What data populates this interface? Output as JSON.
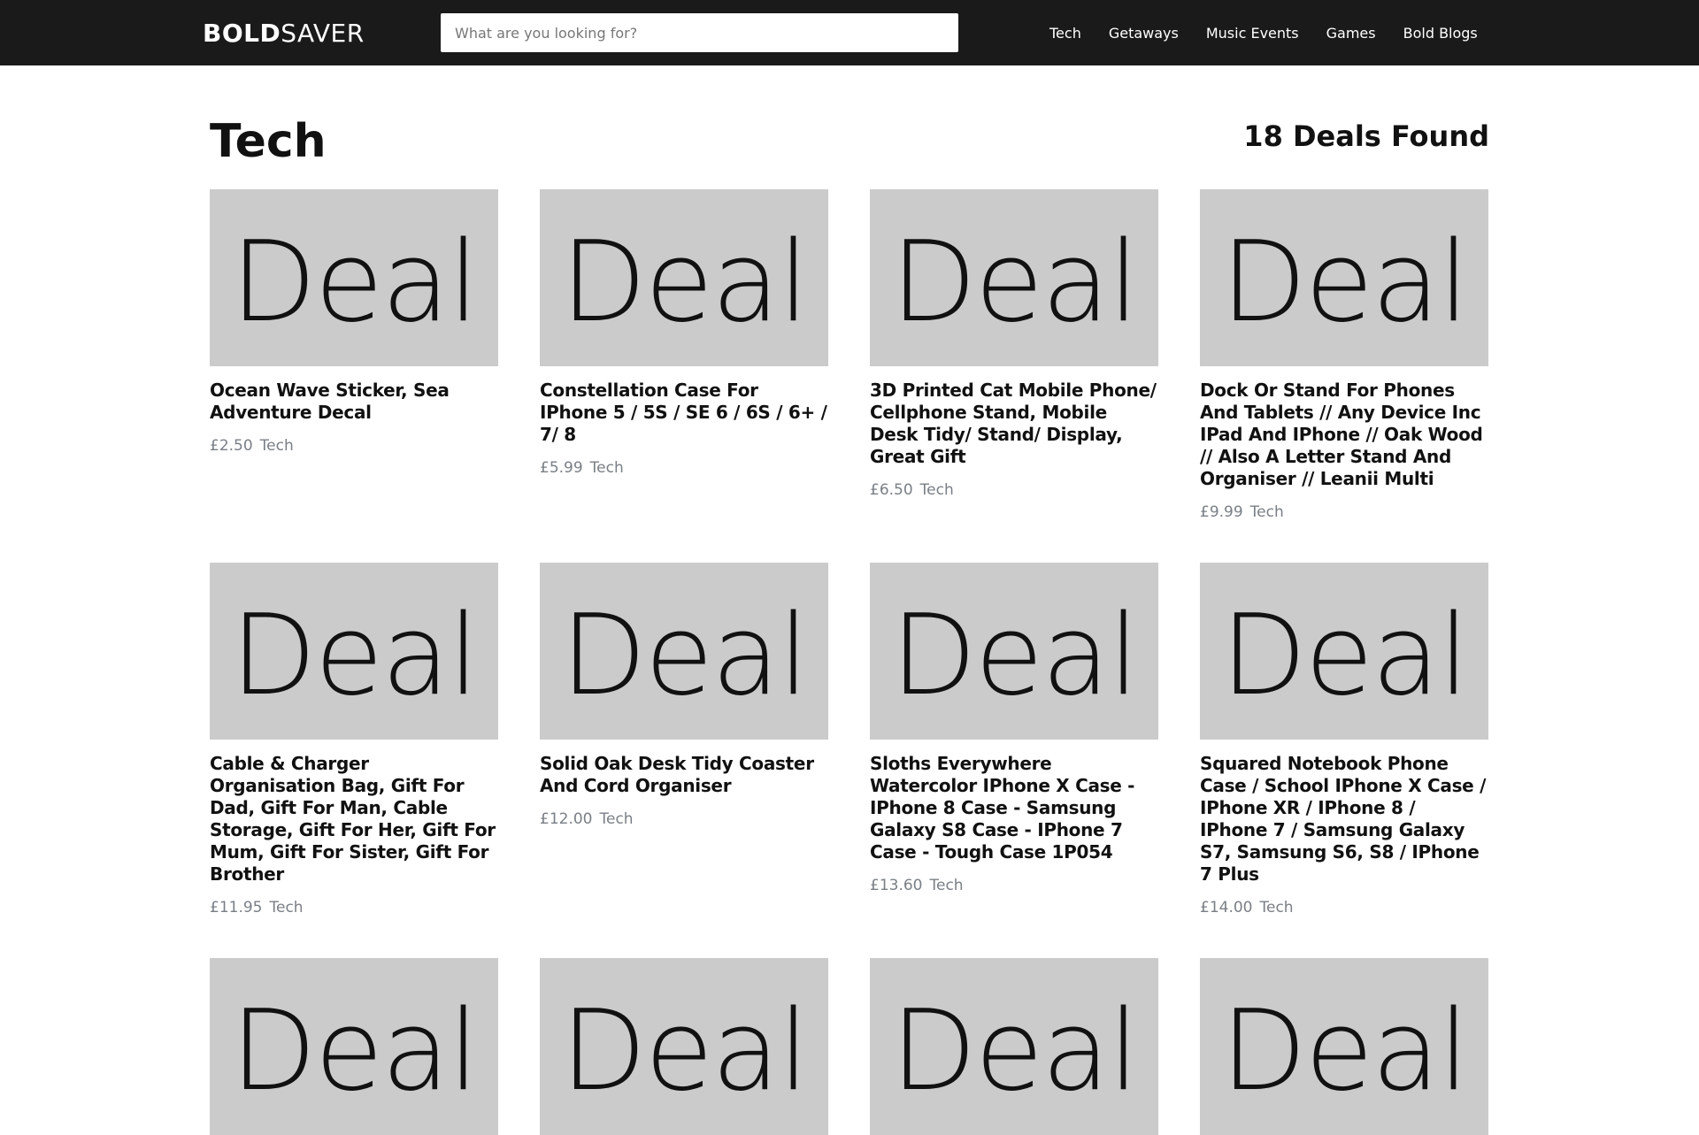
{
  "header": {
    "logo_bold": "BOLD",
    "logo_light": "SAVER",
    "search_placeholder": "What are you looking for?",
    "nav": [
      "Tech",
      "Getaways",
      "Music Events",
      "Games",
      "Bold Blogs"
    ]
  },
  "page": {
    "title": "Tech",
    "deals_found": "18 Deals Found"
  },
  "deals": [
    {
      "thumb": "Deal",
      "title": "Ocean Wave Sticker, Sea Adventure Decal",
      "price": "£2.50",
      "category": "Tech"
    },
    {
      "thumb": "Deal",
      "title": "Constellation Case For IPhone 5 / 5S / SE 6 / 6S / 6+ / 7/ 8",
      "price": "£5.99",
      "category": "Tech"
    },
    {
      "thumb": "Deal",
      "title": "3D Printed Cat Mobile Phone/ Cellphone Stand, Mobile Desk Tidy/ Stand/ Display, Great Gift",
      "price": "£6.50",
      "category": "Tech"
    },
    {
      "thumb": "Deal",
      "title": "Dock Or Stand For Phones And Tablets // Any Device Inc IPad And IPhone // Oak Wood // Also A Letter Stand And Organiser // Leanii Multi",
      "price": "£9.99",
      "category": "Tech"
    },
    {
      "thumb": "Deal",
      "title": "Cable & Charger Organisation Bag, Gift For Dad, Gift For Man, Cable Storage, Gift For Her, Gift For Mum, Gift For Sister, Gift For Brother",
      "price": "£11.95",
      "category": "Tech"
    },
    {
      "thumb": "Deal",
      "title": "Solid Oak Desk Tidy Coaster And Cord Organiser",
      "price": "£12.00",
      "category": "Tech"
    },
    {
      "thumb": "Deal",
      "title": "Sloths Everywhere Watercolor IPhone X Case - IPhone 8 Case - Samsung Galaxy S8 Case - IPhone 7 Case - Tough Case 1P054",
      "price": "£13.60",
      "category": "Tech"
    },
    {
      "thumb": "Deal",
      "title": "Squared Notebook Phone Case / School IPhone X Case / IPhone XR / IPhone 8 / IPhone 7 / Samsung Galaxy S7, Samsung S6, S8 / IPhone 7 Plus",
      "price": "£14.00",
      "category": "Tech"
    },
    {
      "thumb": "Deal",
      "title": "",
      "price": "",
      "category": ""
    },
    {
      "thumb": "Deal",
      "title": "",
      "price": "",
      "category": ""
    },
    {
      "thumb": "Deal",
      "title": "",
      "price": "",
      "category": ""
    },
    {
      "thumb": "Deal",
      "title": "",
      "price": "",
      "category": ""
    }
  ]
}
